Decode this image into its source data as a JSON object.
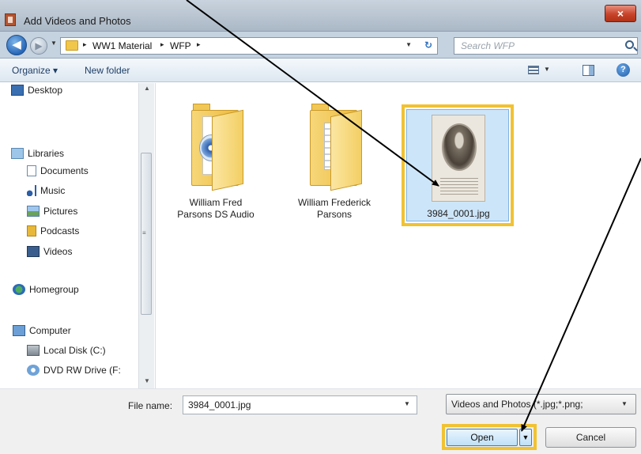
{
  "window": {
    "title": "Add Videos and Photos",
    "close_glyph": "×"
  },
  "nav": {
    "back_glyph": "◀",
    "forward_glyph": "▶",
    "recent_glyph": "▼",
    "address": {
      "crumbs": [
        "WW1 Material",
        "WFP"
      ],
      "separator": "▸",
      "dropdown_glyph": "▼",
      "refresh_glyph": "↻"
    },
    "search": {
      "placeholder": "Search WFP"
    }
  },
  "toolbar": {
    "organize_label": "Organize ▾",
    "new_folder_label": "New folder",
    "view_dropdown_glyph": "▼",
    "help_glyph": "?"
  },
  "sidebar": {
    "items": [
      {
        "label": "Desktop",
        "icon": "desktop-icon"
      },
      {
        "label": "Libraries",
        "icon": "libraries-icon"
      },
      {
        "label": "Documents",
        "icon": "documents-icon"
      },
      {
        "label": "Music",
        "icon": "music-icon"
      },
      {
        "label": "Pictures",
        "icon": "pictures-icon"
      },
      {
        "label": "Podcasts",
        "icon": "podcasts-icon"
      },
      {
        "label": "Videos",
        "icon": "videos-icon"
      },
      {
        "label": "Homegroup",
        "icon": "homegroup-icon"
      },
      {
        "label": "Computer",
        "icon": "computer-icon"
      },
      {
        "label": "Local Disk (C:)",
        "icon": "local-disk-icon"
      },
      {
        "label": "DVD RW Drive (F:",
        "icon": "dvd-drive-icon"
      }
    ],
    "scroll_up_glyph": "▲",
    "scroll_down_glyph": "▼",
    "scroll_grip_glyph": "≡"
  },
  "files": [
    {
      "name_line1": "William Fred",
      "name_line2": "Parsons DS Audio",
      "type": "folder"
    },
    {
      "name_line1": "William Frederick",
      "name_line2": "Parsons",
      "type": "folder"
    },
    {
      "name": "3984_0001.jpg",
      "type": "image",
      "selected": true
    }
  ],
  "bottom": {
    "file_name_label": "File name:",
    "file_name_value": "3984_0001.jpg",
    "file_name_dropdown_glyph": "▼",
    "file_type_value": "Videos and Photos (*.jpg;*.png;",
    "file_type_dropdown_glyph": "▼",
    "open_label": "Open",
    "open_split_glyph": "▼",
    "cancel_label": "Cancel"
  },
  "colors": {
    "highlight": "#f1c232",
    "annotation_arrow": "#000000"
  }
}
